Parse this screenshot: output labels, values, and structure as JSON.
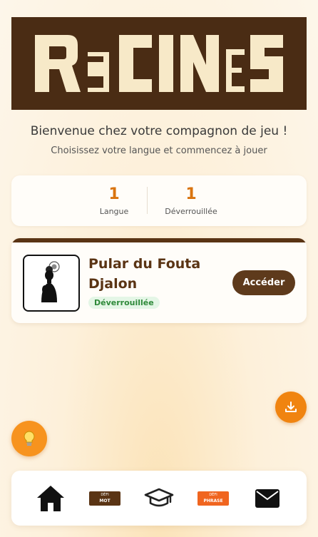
{
  "header": {
    "logo_text": "RaCINES"
  },
  "welcome": {
    "title": "Bienvenue chez votre compagnon de jeu !",
    "subtitle": "Choisissez votre langue et commencez à jouer"
  },
  "stats": [
    {
      "value": "1",
      "label": "Langue"
    },
    {
      "value": "1",
      "label": "Déverrouillée"
    }
  ],
  "language_card": {
    "name": "Pular du Fouta Djalon",
    "badge": "Déverrouillée",
    "action_label": "Accéder"
  },
  "fab": {
    "download_icon": "download-icon",
    "tip_icon": "lightbulb-icon"
  },
  "nav": {
    "items": [
      {
        "icon": "home-icon"
      },
      {
        "icon": "defi-mot-icon",
        "line1": "DÉFI",
        "line2": "MOT"
      },
      {
        "icon": "graduation-cap-icon"
      },
      {
        "icon": "defi-phrase-icon",
        "line1": "DÉFI",
        "line2": "PHRASE"
      },
      {
        "icon": "mail-icon"
      }
    ]
  },
  "colors": {
    "brand_brown": "#4a2c14",
    "logo_cream": "#f7e9c8",
    "accent_orange": "#f08410",
    "badge_green": "#2f8a3a"
  }
}
